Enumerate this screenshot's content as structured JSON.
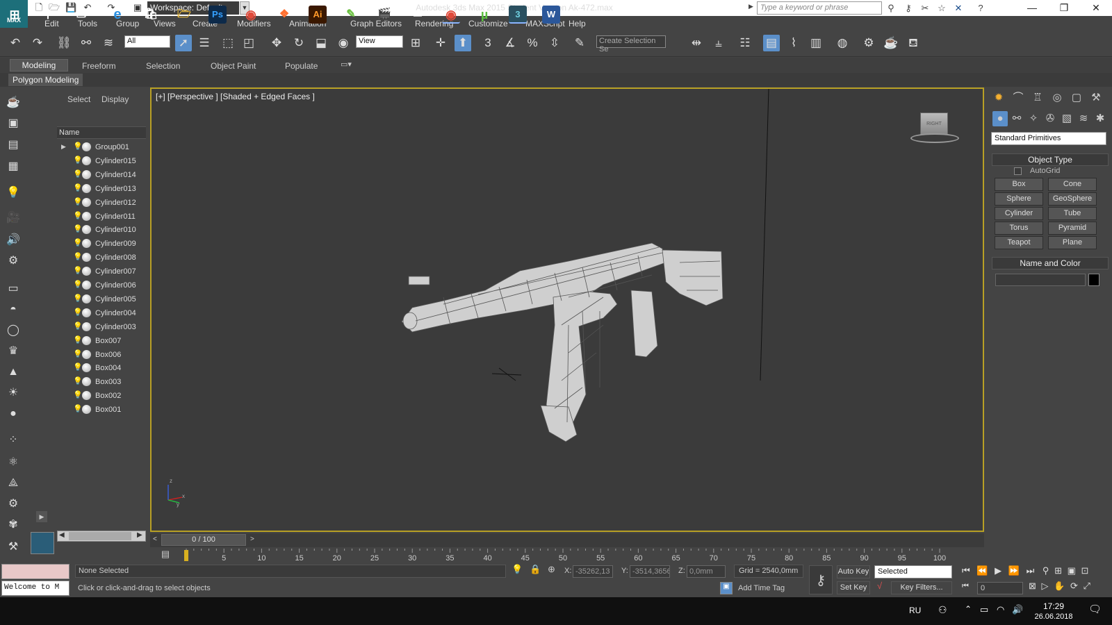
{
  "app": {
    "logo": "MAX",
    "title": "Autodesk 3ds Max  2015    Student Version    Ak-472.max",
    "workspace": "Workspace: Default",
    "search_placeholder": "Type a keyword or phrase"
  },
  "menu": [
    "Edit",
    "Tools",
    "Group",
    "Views",
    "Create",
    "Modifiers",
    "Animation",
    "Graph Editors",
    "Rendering",
    "Customize",
    "MAXScript",
    "Help"
  ],
  "toolbar": {
    "filter": "All",
    "refcoord": "View",
    "snap_angle": "3",
    "create_selection_set": "Create Selection Se"
  },
  "ribbon": {
    "tabs": [
      "Modeling",
      "Freeform",
      "Selection",
      "Object Paint",
      "Populate"
    ],
    "sub": "Polygon Modeling"
  },
  "scene_explorer": {
    "tabs": [
      "Select",
      "Display"
    ],
    "column": "Name",
    "items": [
      "Group001",
      "Cylinder015",
      "Cylinder014",
      "Cylinder013",
      "Cylinder012",
      "Cylinder011",
      "Cylinder010",
      "Cylinder009",
      "Cylinder008",
      "Cylinder007",
      "Cylinder006",
      "Cylinder005",
      "Cylinder004",
      "Cylinder003",
      "Box007",
      "Box006",
      "Box004",
      "Box003",
      "Box002",
      "Box001"
    ]
  },
  "viewport": {
    "label": "[+] [Perspective ] [Shaded + Edged Faces ]",
    "viewcube": "RIGHT",
    "axis_x": "x",
    "axis_y": "y",
    "axis_z": "z"
  },
  "command_panel": {
    "dropdown": "Standard Primitives",
    "rollout_object_type": "Object Type",
    "autogrid": "AutoGrid",
    "buttons": [
      "Box",
      "Cone",
      "Sphere",
      "GeoSphere",
      "Cylinder",
      "Tube",
      "Torus",
      "Pyramid",
      "Teapot",
      "Plane"
    ],
    "rollout_name_color": "Name and Color",
    "object_color": "#000000"
  },
  "timeline": {
    "frame": "0 / 100",
    "ticks": [
      "5",
      "10",
      "15",
      "20",
      "25",
      "30",
      "35",
      "40",
      "45",
      "50",
      "55",
      "60",
      "65",
      "70",
      "75",
      "80",
      "85",
      "90",
      "95",
      "100"
    ]
  },
  "status": {
    "selection": "None Selected",
    "prompt": "Click or click-and-drag to select objects",
    "listener": "Welcome to M",
    "x_label": "X:",
    "x_value": "-35262,13",
    "y_label": "Y:",
    "y_value": "-3514,3656",
    "z_label": "Z:",
    "z_value": "0,0mm",
    "grid": "Grid = 2540,0mm",
    "add_time_tag": "Add Time Tag",
    "auto_key": "Auto Key",
    "set_key": "Set Key",
    "selected": "Selected",
    "key_filters": "Key Filters...",
    "current_frame": "0"
  },
  "taskbar": {
    "lang": "RU",
    "time": "17:29",
    "date": "26.06.2018"
  }
}
